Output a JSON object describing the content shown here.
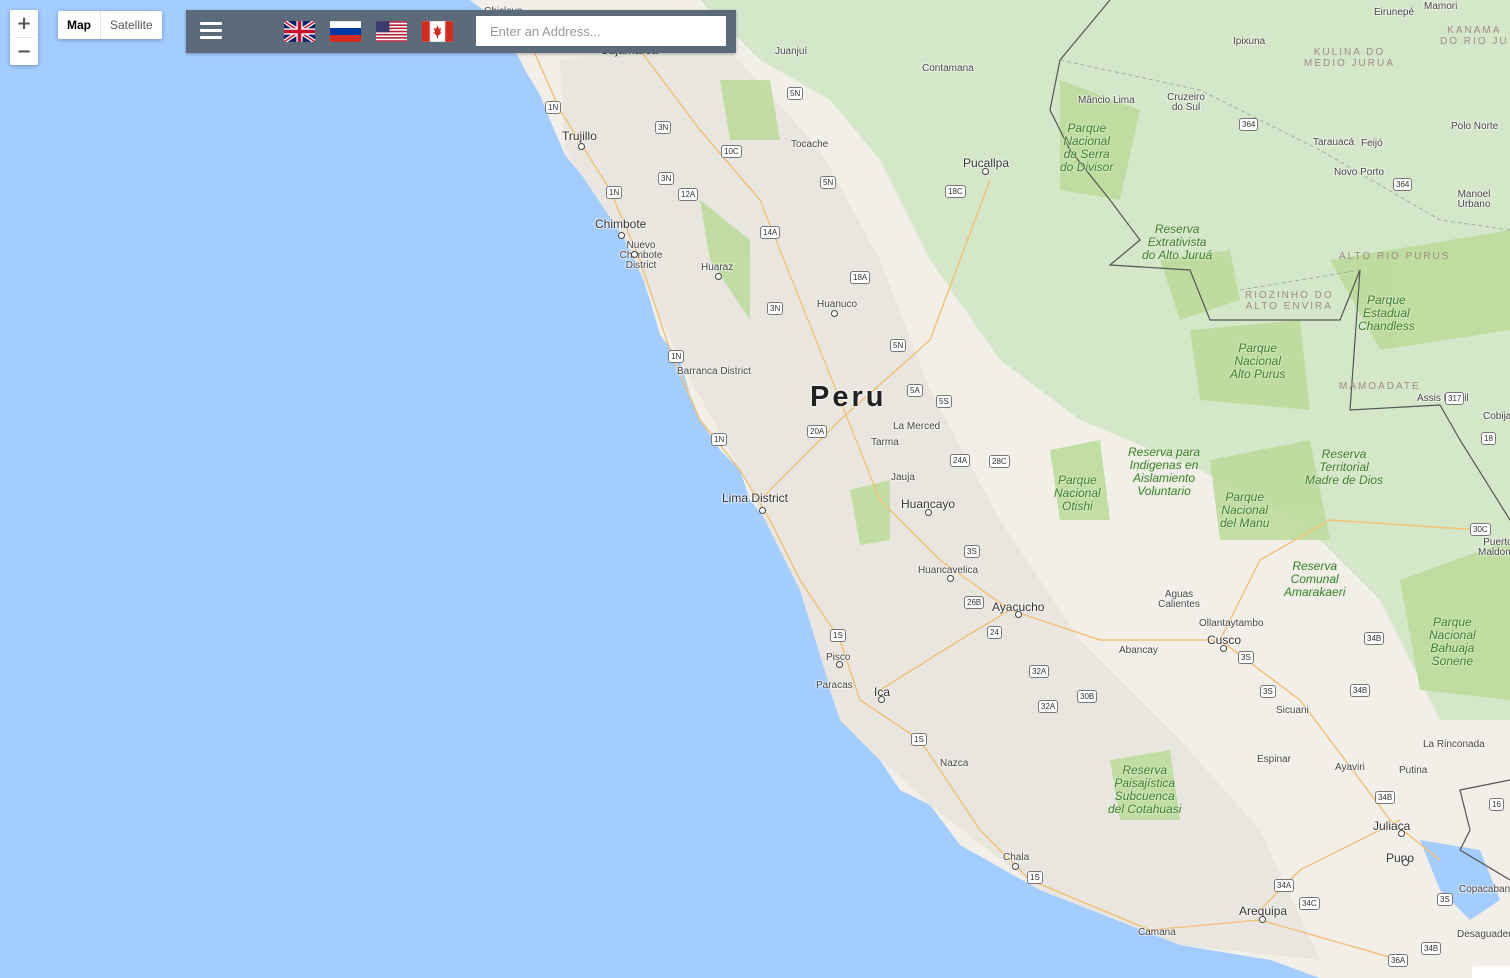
{
  "controls": {
    "zoom_in": "+",
    "zoom_out": "−",
    "map_tab": "Map",
    "satellite_tab": "Satellite"
  },
  "toolbar": {
    "menu_icon": "hamburger-menu-icon",
    "flags": [
      {
        "name": "uk-flag-icon"
      },
      {
        "name": "russia-flag-icon"
      },
      {
        "name": "usa-flag-icon"
      },
      {
        "name": "canada-flag-icon"
      }
    ],
    "address_placeholder": "Enter an Address..."
  },
  "map": {
    "colors": {
      "water": "#a3ccff",
      "land": "#f2efe9",
      "andes": "#e7e6e1",
      "amazon": "#d5e7c9",
      "park": "#bddb9c",
      "border": "#555555",
      "road": "#f1c27a"
    },
    "country": "Peru",
    "cities": [
      {
        "name": "Chiclayo"
      },
      {
        "name": "Cajamarca"
      },
      {
        "name": "Juanjuí"
      },
      {
        "name": "Contamana"
      },
      {
        "name": "Trujillo"
      },
      {
        "name": "Tocache"
      },
      {
        "name": "Pucallpa"
      },
      {
        "name": "Chimbote"
      },
      {
        "name": "Nuevo Chimbote District"
      },
      {
        "name": "Huaraz"
      },
      {
        "name": "Huanuco"
      },
      {
        "name": "Barranca District"
      },
      {
        "name": "La Merced"
      },
      {
        "name": "Tarma"
      },
      {
        "name": "Jauja"
      },
      {
        "name": "Lima District"
      },
      {
        "name": "Huancayo"
      },
      {
        "name": "Huancavelica"
      },
      {
        "name": "Ayacucho"
      },
      {
        "name": "Aguas Calientes"
      },
      {
        "name": "Ollantaytambo"
      },
      {
        "name": "Cusco"
      },
      {
        "name": "Abancay"
      },
      {
        "name": "Pisco"
      },
      {
        "name": "Paracas"
      },
      {
        "name": "Ica"
      },
      {
        "name": "Sicuani"
      },
      {
        "name": "Nazca"
      },
      {
        "name": "Espinar"
      },
      {
        "name": "Ayaviri"
      },
      {
        "name": "Putina"
      },
      {
        "name": "La Rinconada"
      },
      {
        "name": "Juliaca"
      },
      {
        "name": "Puno"
      },
      {
        "name": "Chala"
      },
      {
        "name": "Arequipa"
      },
      {
        "name": "Camana"
      },
      {
        "name": "Copacabana"
      },
      {
        "name": "Desaguadero"
      },
      {
        "name": "Eirunepé"
      },
      {
        "name": "Mamori"
      },
      {
        "name": "Ipixuna"
      },
      {
        "name": "Mâncio Lima"
      },
      {
        "name": "Cruzeiro do Sul"
      },
      {
        "name": "Tarauacá"
      },
      {
        "name": "Feijó"
      },
      {
        "name": "Novo Porto"
      },
      {
        "name": "Polo Norte"
      },
      {
        "name": "Manoel Urbano"
      },
      {
        "name": "Assis Brasil"
      },
      {
        "name": "Cobija"
      },
      {
        "name": "Puerto Maldonado"
      }
    ],
    "parks": [
      {
        "name": "Parque\nNacional\nda Serra\ndo Divisor"
      },
      {
        "name": "Reserva\nExtrativista\ndo Alto Juruá"
      },
      {
        "name": "Parque\nEstadual\nChandless"
      },
      {
        "name": "Parque\nNacional\nAlto Purus"
      },
      {
        "name": "Reserva para\nIndigenas en\nAislamiento\nVoluntario"
      },
      {
        "name": "Parque\nNacional\nOtishi"
      },
      {
        "name": "Parque\nNacional\ndel Manu"
      },
      {
        "name": "Reserva\nTerritorial\nMadre de Dios"
      },
      {
        "name": "Reserva\nComunal\nAmarakaeri"
      },
      {
        "name": "Parque\nNacional\nBahuaja\nSonene"
      },
      {
        "name": "Reserva\nPaisajística\nSubcuenca\ndel Cotahuasi"
      }
    ],
    "regions": [
      {
        "name": "KANAMA\nDO RIO JU"
      },
      {
        "name": "KULINA DO\nMEDIO JURUA"
      },
      {
        "name": "ALTO RIO PURUS"
      },
      {
        "name": "RIOZINHO DO\nALTO ENVIRA"
      },
      {
        "name": "MAMOADATE"
      }
    ],
    "routes": [
      "1N",
      "3N",
      "5N",
      "10C",
      "3N",
      "12A",
      "1N",
      "18C",
      "5N",
      "14A",
      "18A",
      "3N",
      "5N",
      "1N",
      "5A",
      "5S",
      "20A",
      "1N",
      "24A",
      "28C",
      "3S",
      "26B",
      "24",
      "1S",
      "32A",
      "30B",
      "32A",
      "1S",
      "34B",
      "3S",
      "3S",
      "34B",
      "34B",
      "16",
      "18",
      "317",
      "30C",
      "364",
      "364",
      "34A",
      "34C",
      "1S",
      "3S",
      "36A",
      "34B"
    ]
  }
}
